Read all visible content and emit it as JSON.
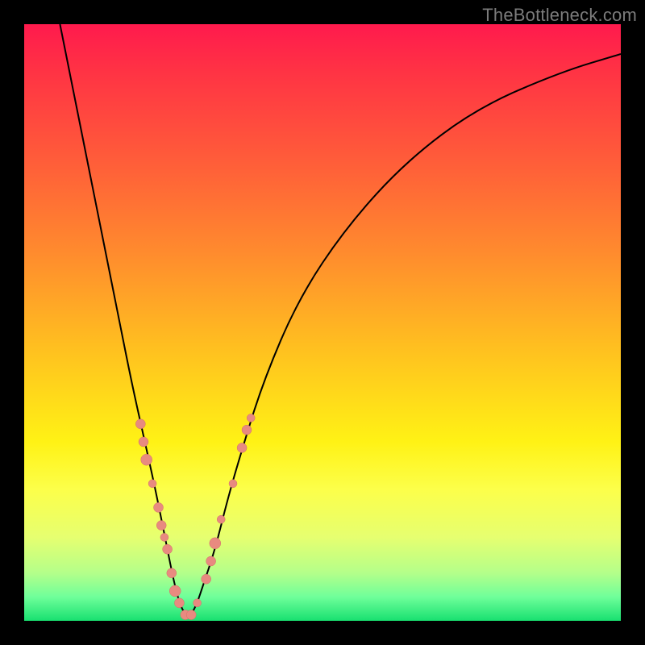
{
  "watermark": "TheBottleneck.com",
  "colors": {
    "curve": "#000000",
    "marker_fill": "#e88a80",
    "marker_stroke": "#d27066",
    "gradient_top": "#ff1a4d",
    "gradient_bottom": "#18e070"
  },
  "chart_data": {
    "type": "line",
    "title": "",
    "xlabel": "",
    "ylabel": "",
    "xlim": [
      0,
      100
    ],
    "ylim": [
      0,
      100
    ],
    "grid": false,
    "description": "Bottleneck-style V curve: percentage deviation vs component index; minimum (~0%) near x≈27; plot background is a vertical red→green gradient indicating severity.",
    "series": [
      {
        "name": "bottleneck-curve",
        "x": [
          6,
          8,
          10,
          12,
          14,
          16,
          18,
          20,
          22,
          24,
          25,
          26,
          27,
          28,
          29,
          30,
          32,
          34,
          36,
          40,
          46,
          54,
          64,
          76,
          90,
          100
        ],
        "y": [
          100,
          90,
          80,
          70,
          60,
          50,
          40,
          31,
          22,
          12,
          7,
          3,
          1,
          1,
          3,
          6,
          12,
          20,
          27,
          40,
          54,
          66,
          77,
          86,
          92,
          95
        ]
      }
    ],
    "markers": [
      {
        "x": 19.5,
        "y": 33,
        "r": 6
      },
      {
        "x": 20.0,
        "y": 30,
        "r": 6
      },
      {
        "x": 20.5,
        "y": 27,
        "r": 7
      },
      {
        "x": 21.5,
        "y": 23,
        "r": 5
      },
      {
        "x": 22.5,
        "y": 19,
        "r": 6
      },
      {
        "x": 23.0,
        "y": 16,
        "r": 6
      },
      {
        "x": 23.5,
        "y": 14,
        "r": 5
      },
      {
        "x": 24.0,
        "y": 12,
        "r": 6
      },
      {
        "x": 24.7,
        "y": 8,
        "r": 6
      },
      {
        "x": 25.3,
        "y": 5,
        "r": 7
      },
      {
        "x": 26.0,
        "y": 3,
        "r": 6
      },
      {
        "x": 27.0,
        "y": 1,
        "r": 6
      },
      {
        "x": 28.0,
        "y": 1,
        "r": 6
      },
      {
        "x": 29.0,
        "y": 3,
        "r": 5
      },
      {
        "x": 30.5,
        "y": 7,
        "r": 6
      },
      {
        "x": 31.3,
        "y": 10,
        "r": 6
      },
      {
        "x": 32.0,
        "y": 13,
        "r": 7
      },
      {
        "x": 33.0,
        "y": 17,
        "r": 5
      },
      {
        "x": 35.0,
        "y": 23,
        "r": 5
      },
      {
        "x": 36.5,
        "y": 29,
        "r": 6
      },
      {
        "x": 37.3,
        "y": 32,
        "r": 6
      },
      {
        "x": 38.0,
        "y": 34,
        "r": 5
      }
    ]
  }
}
